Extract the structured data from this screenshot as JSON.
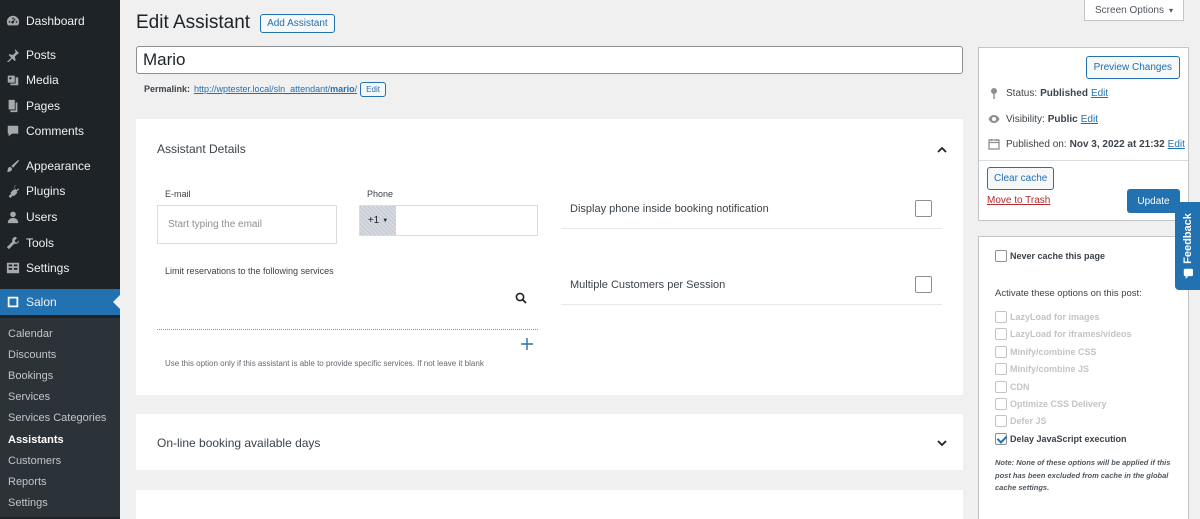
{
  "sidebar": {
    "items": [
      {
        "label": "Dashboard",
        "icon": "dashboard-icon"
      },
      {
        "label": "Posts",
        "icon": "pin-icon"
      },
      {
        "label": "Media",
        "icon": "media-icon"
      },
      {
        "label": "Pages",
        "icon": "pages-icon"
      },
      {
        "label": "Comments",
        "icon": "comments-icon"
      },
      {
        "label": "Appearance",
        "icon": "brush-icon"
      },
      {
        "label": "Plugins",
        "icon": "plugin-icon"
      },
      {
        "label": "Users",
        "icon": "users-icon"
      },
      {
        "label": "Tools",
        "icon": "wrench-icon"
      },
      {
        "label": "Settings",
        "icon": "settings-icon"
      },
      {
        "label": "Salon",
        "icon": "salon-icon"
      }
    ],
    "submenu": [
      "Calendar",
      "Discounts",
      "Bookings",
      "Services",
      "Services Categories",
      "Assistants",
      "Customers",
      "Reports",
      "Settings"
    ],
    "submenu_current": "Assistants"
  },
  "header": {
    "title": "Edit Assistant",
    "add_button": "Add Assistant",
    "screen_options": "Screen Options"
  },
  "post": {
    "title_value": "Mario",
    "permalink_label": "Permalink:",
    "permalink_prefix": "http://wptester.local/sln_attendant/",
    "permalink_slug": "mario",
    "permalink_suffix": "/",
    "permalink_edit": "Edit"
  },
  "details": {
    "title": "Assistant Details",
    "email_label": "E-mail",
    "email_placeholder": "Start typing the email",
    "phone_label": "Phone",
    "phone_code": "+1",
    "services_label": "Limit reservations to the following services",
    "services_hint": "Use this option only if this assistant is able to provide specific services. If not leave it blank",
    "toggle_phone": "Display phone inside booking notification",
    "toggle_multiple": "Multiple Customers per Session"
  },
  "online_booking": {
    "title": "On-line booking available days"
  },
  "publish": {
    "preview": "Preview Changes",
    "status_label": "Status:",
    "status_value": "Published",
    "visibility_label": "Visibility:",
    "visibility_value": "Public",
    "published_label": "Published on:",
    "published_value": "Nov 3, 2022 at 21:32",
    "edit": "Edit",
    "clear_cache": "Clear cache",
    "trash": "Move to Trash",
    "update": "Update"
  },
  "cache": {
    "never_cache": "Never cache this page",
    "activate_label": "Activate these options on this post:",
    "options": [
      "LazyLoad for images",
      "LazyLoad for iframes/videos",
      "Minify/combine CSS",
      "Minify/combine JS",
      "CDN",
      "Optimize CSS Delivery",
      "Defer JS"
    ],
    "delay_js": "Delay JavaScript execution",
    "note": "Note: None of these options will be applied if this post has been excluded from cache in the global cache settings."
  },
  "feedback": "Feedback",
  "colors": {
    "sidebar_bg": "#1d2327",
    "accent": "#2271b1",
    "danger": "#b32d2e",
    "page_bg": "#f0f0f1"
  }
}
